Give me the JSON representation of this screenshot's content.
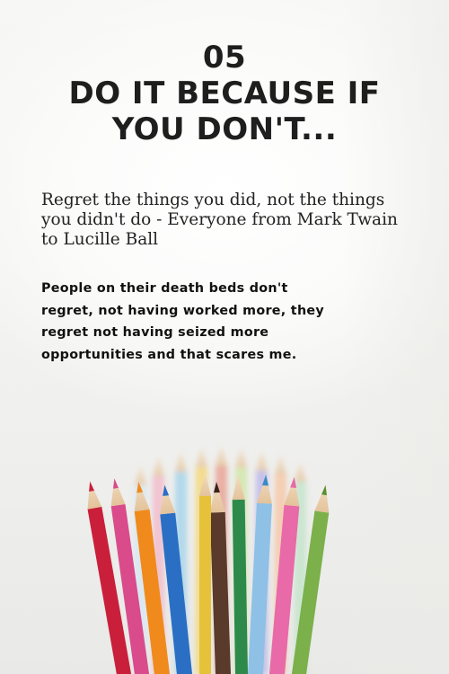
{
  "headline": {
    "number": "05",
    "line1": "DO IT BECAUSE IF",
    "line2": "YOU DON'T..."
  },
  "quote": "Regret the things you did, not the things you didn't do - Everyone from Mark Twain to Lucille Ball",
  "body": "People on their death beds don't regret, not having worked more, they regret not having seized more opportunities and that scares me.",
  "photo": {
    "subject": "colored-pencils-in-cup",
    "pencil_colors": [
      "#c91f3a",
      "#d94b8a",
      "#f08a1c",
      "#2a6fc4",
      "#5a3a2a",
      "#8fc1e6",
      "#e86aa8",
      "#7bb04a",
      "#e6c23a",
      "#2e8a4a"
    ]
  }
}
